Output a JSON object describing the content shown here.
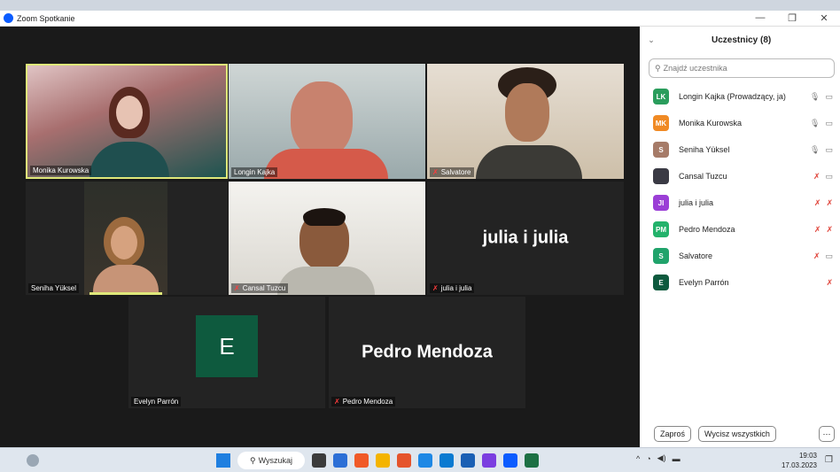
{
  "window": {
    "title": "Zoom Spotkanie",
    "controls": [
      "—",
      "❐",
      "✕"
    ]
  },
  "tiles": [
    {
      "name": "Monika Kurowska",
      "muted": false
    },
    {
      "name": "Longin Kajka",
      "muted": false
    },
    {
      "name": "Salvatore",
      "muted": true
    },
    {
      "name": "Seniha Yüksel",
      "muted": false
    },
    {
      "name": "Cansal Tuzcu",
      "muted": true
    },
    {
      "name": "julia i julia",
      "muted": true,
      "display": "julia i julia"
    },
    {
      "name": "Evelyn Parrón",
      "muted": false,
      "avatar": "E"
    },
    {
      "name": "Pedro Mendoza",
      "muted": true,
      "display": "Pedro Mendoza"
    }
  ],
  "participants_panel": {
    "title": "Uczestnicy (8)",
    "search_placeholder": "Znajdź uczestnika",
    "items": [
      {
        "initials": "LK",
        "color": "#2a9d5c",
        "name": "Longin Kajka (Prowadzący, ja)",
        "mic": "🎙",
        "cam": "▭"
      },
      {
        "initials": "MK",
        "color": "#f08a24",
        "name": "Monika Kurowska",
        "mic": "🎙",
        "cam": "▭"
      },
      {
        "initials": "S",
        "color": "#a67b68",
        "name": "Seniha Yüksel",
        "mic": "🎙",
        "cam": "▭"
      },
      {
        "initials": "",
        "color": "#3a3a44",
        "name": "Cansal Tuzcu",
        "mic": "✗",
        "cam": "▭"
      },
      {
        "initials": "JI",
        "color": "#9b3fd6",
        "name": "julia i julia",
        "mic": "✗",
        "cam": "✗"
      },
      {
        "initials": "PM",
        "color": "#23b26b",
        "name": "Pedro Mendoza",
        "mic": "✗",
        "cam": "✗"
      },
      {
        "initials": "S",
        "color": "#20a36b",
        "name": "Salvatore",
        "mic": "✗",
        "cam": "▭"
      },
      {
        "initials": "E",
        "color": "#0e5a3e",
        "name": "Evelyn Parrón",
        "mic": "",
        "cam": "✗"
      }
    ],
    "invite_label": "Zaproś",
    "mute_all_label": "Wycisz wszystkich",
    "more_label": "···"
  },
  "taskbar": {
    "search_label": "Wyszukaj",
    "time": "19:03",
    "date": "17.03.2023",
    "apps": [
      "#3b3b3b",
      "#2c6fd6",
      "#f05a28",
      "#f4b400",
      "#e5542c",
      "#1e88e5",
      "#0a7ad1",
      "#1a5fb4",
      "#7b3ee0",
      "#0b5cff",
      "#1d7044"
    ]
  }
}
